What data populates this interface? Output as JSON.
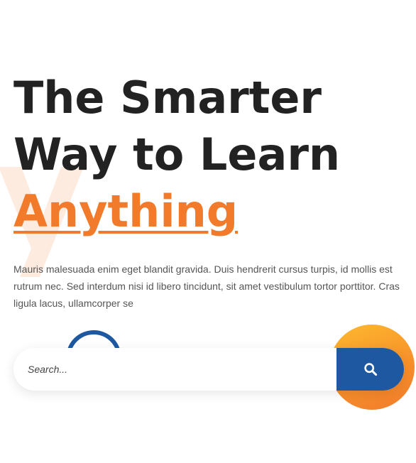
{
  "hero": {
    "background_letter": "y",
    "headline": {
      "line1": "The Smarter",
      "line2": "Way to Learn",
      "highlight": "Anything"
    },
    "description": "Mauris malesuada enim eget blandit gravida. Duis hendrerit cursus turpis, id mollis est rutrum nec. Sed interdum nisi id libero tincidunt, sit amet vestibulum tortor porttitor. Cras ligula lacus, ullamcorper se"
  },
  "search": {
    "placeholder": "Search...",
    "button_icon": "search-icon"
  },
  "colors": {
    "heading": "#222222",
    "accent_orange": "#F27B2B",
    "accent_blue": "#1E58A1",
    "gradient_start": "#FDBA2E",
    "gradient_end": "#F27B2B",
    "body_text": "#555555"
  }
}
